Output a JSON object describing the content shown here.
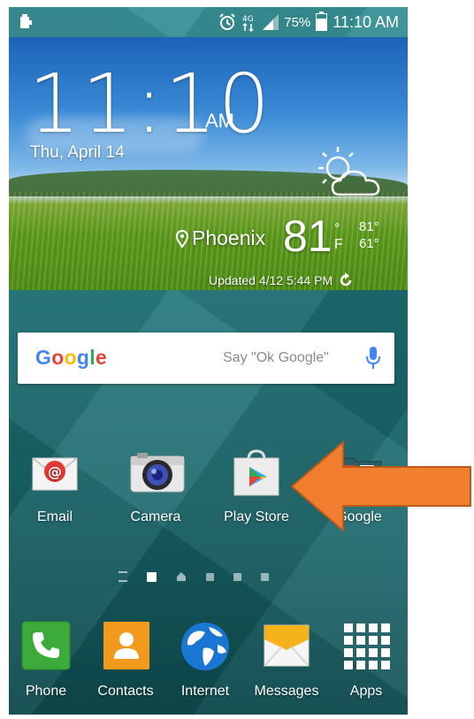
{
  "status_bar": {
    "battery_percent": "75%",
    "battery_level": 0.75,
    "time": "11:10 AM",
    "icons": [
      "notification-icon",
      "alarm-icon",
      "data-icon",
      "signal-icon",
      "battery-icon"
    ]
  },
  "widget": {
    "clock": "11:10",
    "ampm": "AM",
    "date": "Thu, April 14",
    "city": "Phoenix",
    "temperature": "81",
    "degree_symbol": "°",
    "unit": "F",
    "high": "81°",
    "low": "61°",
    "updated": "Updated 4/12 5:44 PM",
    "weather_icon": "partly-sunny-icon"
  },
  "search": {
    "logo": [
      "G",
      "o",
      "o",
      "g",
      "l",
      "e"
    ],
    "logo_colors": [
      "#4285F4",
      "#EA4335",
      "#FBBC05",
      "#4285F4",
      "#34A853",
      "#EA4335"
    ],
    "hint": "Say \"Ok Google\"",
    "mic_color": "#4285F4"
  },
  "home_apps": [
    {
      "label": "Email",
      "icon": "email-icon"
    },
    {
      "label": "Camera",
      "icon": "camera-icon"
    },
    {
      "label": "Play Store",
      "icon": "play-store-icon"
    },
    {
      "label": "Google",
      "icon": "google-folder-icon"
    }
  ],
  "page_indicators": {
    "count": 6,
    "active_index": 1
  },
  "dock": [
    {
      "label": "Phone",
      "icon": "phone-icon"
    },
    {
      "label": "Contacts",
      "icon": "contacts-icon"
    },
    {
      "label": "Internet",
      "icon": "globe-icon"
    },
    {
      "label": "Messages",
      "icon": "messages-icon"
    },
    {
      "label": "Apps",
      "icon": "apps-grid-icon"
    }
  ],
  "colors": {
    "arrow": "#F07E2E",
    "wallpaper": "#1e7479",
    "phone_green": "#3DAA3C",
    "contacts_orange": "#F29A1E"
  }
}
